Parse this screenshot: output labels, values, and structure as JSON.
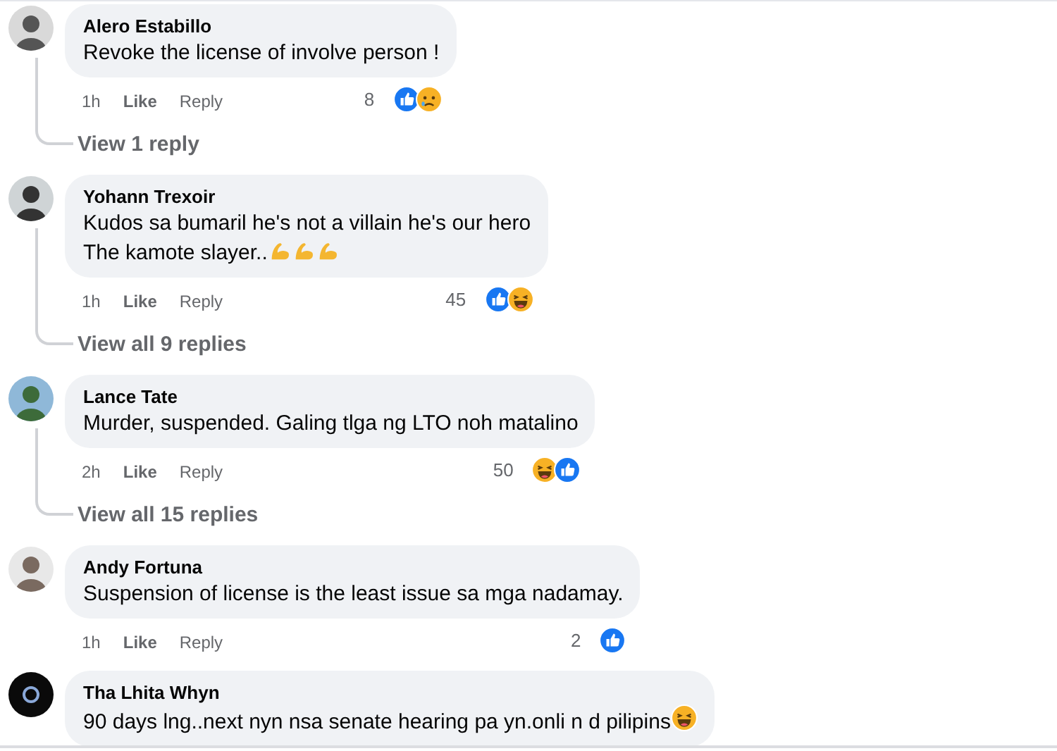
{
  "comments": [
    {
      "author": "Alero Estabillo",
      "text": "Revoke the license of involve person !",
      "time": "1h",
      "like": "Like",
      "reply": "Reply",
      "reaction_count": "8",
      "reactions": [
        {
          "kind": "like"
        },
        {
          "kind": "sad"
        }
      ],
      "replies_link": "View 1 reply"
    },
    {
      "author": "Yohann Trexoir",
      "text": "Kudos sa bumaril he's not a villain he's our hero\nThe kamote slayer..",
      "emoji": [
        {
          "kind": "biceps"
        },
        {
          "kind": "biceps"
        },
        {
          "kind": "biceps"
        }
      ],
      "time": "1h",
      "like": "Like",
      "reply": "Reply",
      "reaction_count": "45",
      "reactions": [
        {
          "kind": "like"
        },
        {
          "kind": "haha"
        }
      ],
      "replies_link": "View all 9 replies"
    },
    {
      "author": "Lance Tate",
      "text": "Murder, suspended. Galing tlga ng LTO noh matalino",
      "time": "2h",
      "like": "Like",
      "reply": "Reply",
      "reaction_count": "50",
      "reactions": [
        {
          "kind": "haha"
        },
        {
          "kind": "like"
        }
      ],
      "replies_link": "View all 15 replies"
    },
    {
      "author": "Andy Fortuna",
      "text": "Suspension of license is the least issue sa mga nadamay.",
      "time": "1h",
      "like": "Like",
      "reply": "Reply",
      "reaction_count": "2",
      "reactions": [
        {
          "kind": "like"
        }
      ]
    },
    {
      "author": "Tha Lhita Whyn",
      "text": "90 days lng..next nyn nsa senate hearing pa yn.onli n d pilipins",
      "emoji": [
        {
          "kind": "haha"
        }
      ]
    }
  ]
}
